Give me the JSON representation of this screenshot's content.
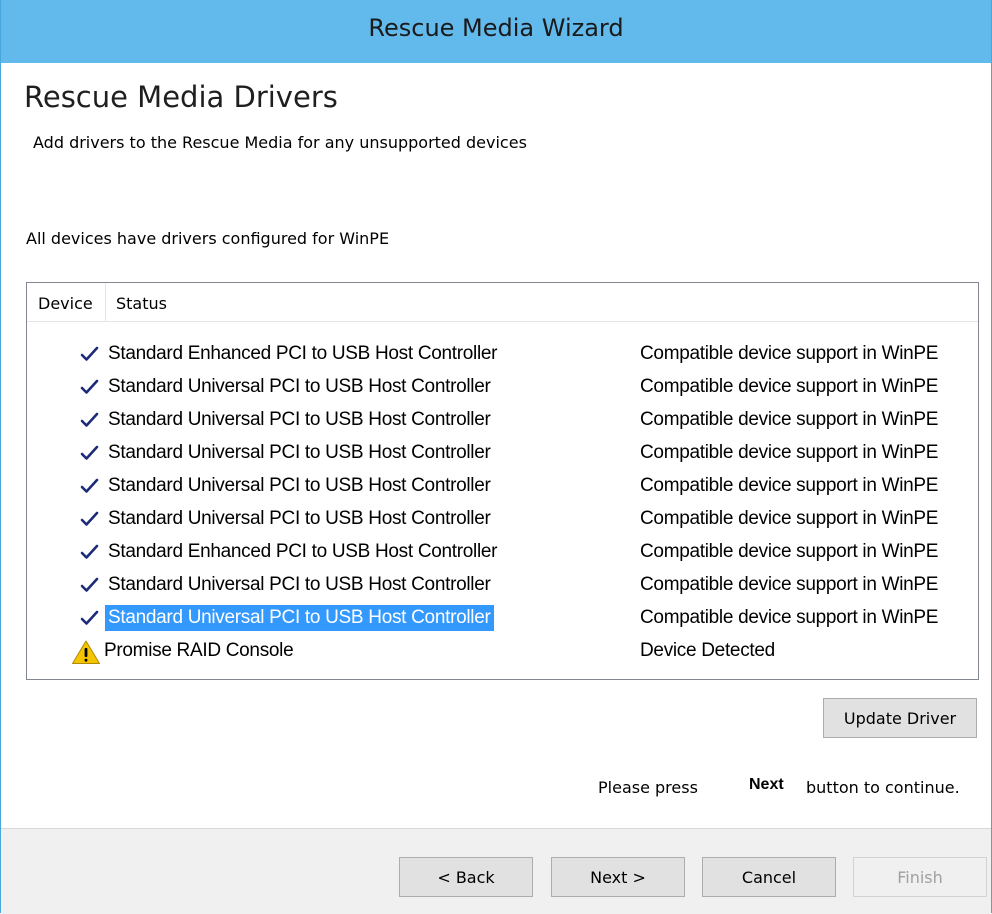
{
  "window": {
    "title": "Rescue Media Wizard"
  },
  "page": {
    "title": "Rescue Media Drivers",
    "subtitle": "Add drivers to the Rescue Media for any unsupported devices",
    "status_message": "All devices have drivers configured for WinPE"
  },
  "device_list": {
    "columns": [
      "Device",
      "Status"
    ],
    "rows": [
      {
        "icon": "check-icon",
        "name": "Standard Enhanced PCI to USB Host Controller",
        "status": "Compatible device support in WinPE",
        "selected": false
      },
      {
        "icon": "check-icon",
        "name": "Standard Universal PCI to USB Host Controller",
        "status": "Compatible device support in WinPE",
        "selected": false
      },
      {
        "icon": "check-icon",
        "name": "Standard Universal PCI to USB Host Controller",
        "status": "Compatible device support in WinPE",
        "selected": false
      },
      {
        "icon": "check-icon",
        "name": "Standard Universal PCI to USB Host Controller",
        "status": "Compatible device support in WinPE",
        "selected": false
      },
      {
        "icon": "check-icon",
        "name": "Standard Universal PCI to USB Host Controller",
        "status": "Compatible device support in WinPE",
        "selected": false
      },
      {
        "icon": "check-icon",
        "name": "Standard Universal PCI to USB Host Controller",
        "status": "Compatible device support in WinPE",
        "selected": false
      },
      {
        "icon": "check-icon",
        "name": "Standard Enhanced PCI to USB Host Controller",
        "status": "Compatible device support in WinPE",
        "selected": false
      },
      {
        "icon": "check-icon",
        "name": "Standard Universal PCI to USB Host Controller",
        "status": "Compatible device support in WinPE",
        "selected": false
      },
      {
        "icon": "check-icon",
        "name": "Standard Universal PCI to USB Host Controller",
        "status": "Compatible device support in WinPE",
        "selected": true
      },
      {
        "icon": "warning-icon",
        "name": "Promise RAID Console",
        "status": "Device Detected",
        "selected": false
      }
    ]
  },
  "buttons": {
    "update_driver": "Update Driver",
    "back": "< Back",
    "next": "Next >",
    "cancel": "Cancel",
    "finish": "Finish"
  },
  "hint": {
    "before": "Please press",
    "bold": "Next",
    "after": "button to continue."
  },
  "colors": {
    "titlebar": "#62b9ec",
    "selection": "#3399ff",
    "check": "#1c2a7a",
    "warning": "#f5c400"
  }
}
